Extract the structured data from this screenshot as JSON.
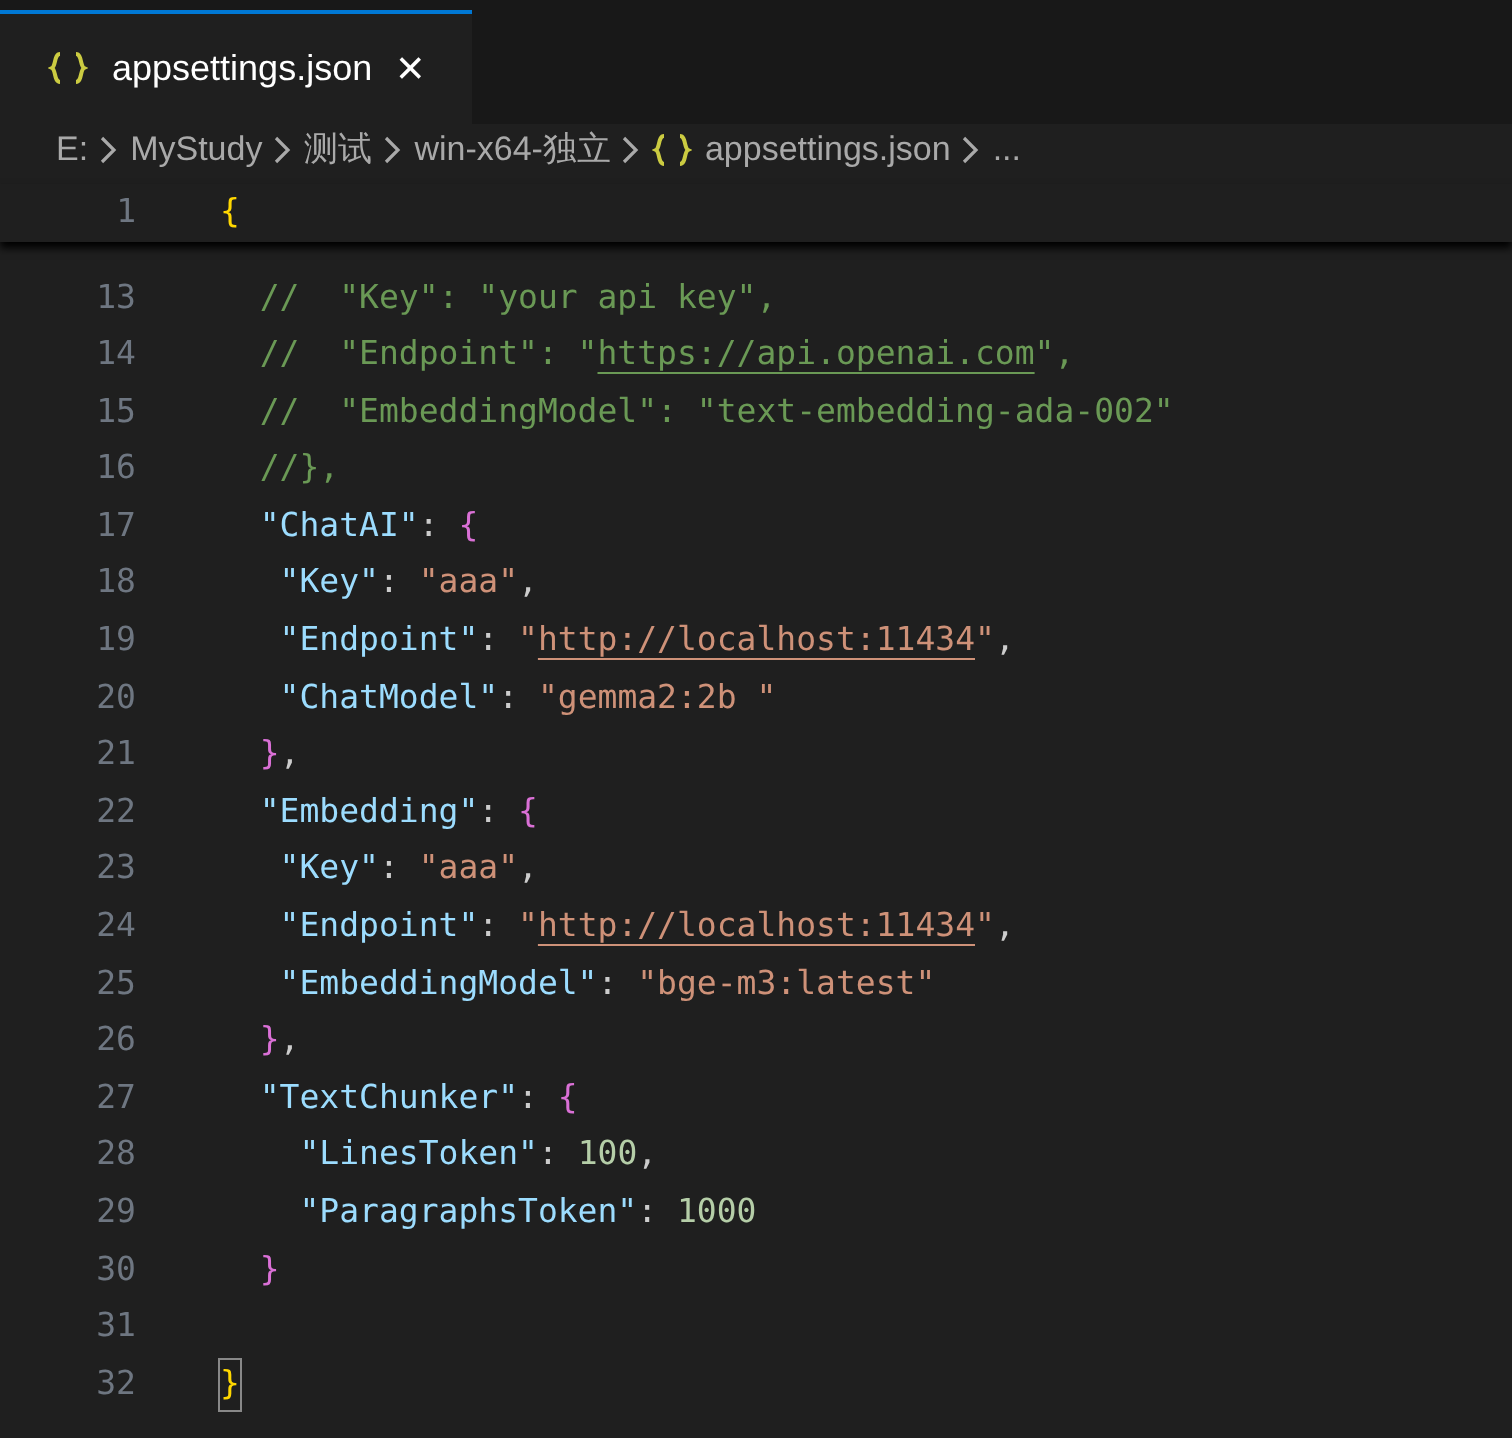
{
  "tabs": [
    {
      "label": "appsettings.json",
      "close": "×",
      "selected": true
    }
  ],
  "breadcrumb": [
    {
      "label": "E:",
      "kind": "folder"
    },
    {
      "label": "MyStudy",
      "kind": "folder"
    },
    {
      "label": "测试",
      "kind": "folder"
    },
    {
      "label": "win-x64-独立",
      "kind": "folder"
    },
    {
      "label": "appsettings.json",
      "kind": "file"
    },
    {
      "label": "...",
      "kind": "more"
    }
  ],
  "sticky_lines": [
    {
      "number": "1",
      "tokens": [
        {
          "kind": "brace_gold",
          "text": "{"
        }
      ]
    }
  ],
  "lines": [
    {
      "number": "13",
      "tokens": [
        {
          "kind": "comment",
          "text": "  //  \"Key\": \"your api key\","
        }
      ]
    },
    {
      "number": "14",
      "tokens": [
        {
          "kind": "comment",
          "text": "  //  \"Endpoint\": \""
        },
        {
          "kind": "comment_link",
          "text": "https://api.openai.com"
        },
        {
          "kind": "comment",
          "text": "\","
        }
      ]
    },
    {
      "number": "15",
      "tokens": [
        {
          "kind": "comment",
          "text": "  //  \"EmbeddingModel\": \"text-embedding-ada-002\""
        }
      ]
    },
    {
      "number": "16",
      "tokens": [
        {
          "kind": "comment",
          "text": "  //},"
        }
      ]
    },
    {
      "number": "17",
      "tokens": [
        {
          "kind": "key",
          "text": "  \"ChatAI\""
        },
        {
          "kind": "punct",
          "text": ": "
        },
        {
          "kind": "brace_pink",
          "text": "{"
        }
      ]
    },
    {
      "number": "18",
      "tokens": [
        {
          "kind": "key",
          "text": "   \"Key\""
        },
        {
          "kind": "punct",
          "text": ": "
        },
        {
          "kind": "string",
          "text": "\"aaa\""
        },
        {
          "kind": "punct",
          "text": ","
        }
      ]
    },
    {
      "number": "19",
      "tokens": [
        {
          "kind": "key",
          "text": "   \"Endpoint\""
        },
        {
          "kind": "punct",
          "text": ": "
        },
        {
          "kind": "string",
          "text": "\""
        },
        {
          "kind": "link",
          "text": "http://localhost:11434"
        },
        {
          "kind": "string",
          "text": "\""
        },
        {
          "kind": "punct",
          "text": ","
        }
      ]
    },
    {
      "number": "20",
      "tokens": [
        {
          "kind": "key",
          "text": "   \"ChatModel\""
        },
        {
          "kind": "punct",
          "text": ": "
        },
        {
          "kind": "string",
          "text": "\"gemma2:2b \""
        }
      ]
    },
    {
      "number": "21",
      "tokens": [
        {
          "kind": "brace_pink",
          "text": "  }"
        },
        {
          "kind": "punct",
          "text": ","
        }
      ]
    },
    {
      "number": "22",
      "tokens": [
        {
          "kind": "key",
          "text": "  \"Embedding\""
        },
        {
          "kind": "punct",
          "text": ": "
        },
        {
          "kind": "brace_pink",
          "text": "{"
        }
      ]
    },
    {
      "number": "23",
      "tokens": [
        {
          "kind": "key",
          "text": "   \"Key\""
        },
        {
          "kind": "punct",
          "text": ": "
        },
        {
          "kind": "string",
          "text": "\"aaa\""
        },
        {
          "kind": "punct",
          "text": ","
        }
      ]
    },
    {
      "number": "24",
      "tokens": [
        {
          "kind": "key",
          "text": "   \"Endpoint\""
        },
        {
          "kind": "punct",
          "text": ": "
        },
        {
          "kind": "string",
          "text": "\""
        },
        {
          "kind": "link",
          "text": "http://localhost:11434"
        },
        {
          "kind": "string",
          "text": "\""
        },
        {
          "kind": "punct",
          "text": ","
        }
      ]
    },
    {
      "number": "25",
      "tokens": [
        {
          "kind": "key",
          "text": "   \"EmbeddingModel\""
        },
        {
          "kind": "punct",
          "text": ": "
        },
        {
          "kind": "string",
          "text": "\"bge-m3:latest\""
        }
      ]
    },
    {
      "number": "26",
      "tokens": [
        {
          "kind": "brace_pink",
          "text": "  }"
        },
        {
          "kind": "punct",
          "text": ","
        }
      ]
    },
    {
      "number": "27",
      "tokens": [
        {
          "kind": "key",
          "text": "  \"TextChunker\""
        },
        {
          "kind": "punct",
          "text": ": "
        },
        {
          "kind": "brace_pink",
          "text": "{"
        }
      ]
    },
    {
      "number": "28",
      "tokens": [
        {
          "kind": "key",
          "text": "    \"LinesToken\""
        },
        {
          "kind": "punct",
          "text": ": "
        },
        {
          "kind": "number",
          "text": "100"
        },
        {
          "kind": "punct",
          "text": ","
        }
      ]
    },
    {
      "number": "29",
      "tokens": [
        {
          "kind": "key",
          "text": "    \"ParagraphsToken\""
        },
        {
          "kind": "punct",
          "text": ": "
        },
        {
          "kind": "number",
          "text": "1000"
        }
      ]
    },
    {
      "number": "30",
      "tokens": [
        {
          "kind": "brace_pink",
          "text": "  }"
        }
      ]
    },
    {
      "number": "31"
    },
    {
      "number": "32",
      "tokens": [
        {
          "kind": "brace_gold",
          "text": "}",
          "matched": true
        }
      ]
    }
  ]
}
